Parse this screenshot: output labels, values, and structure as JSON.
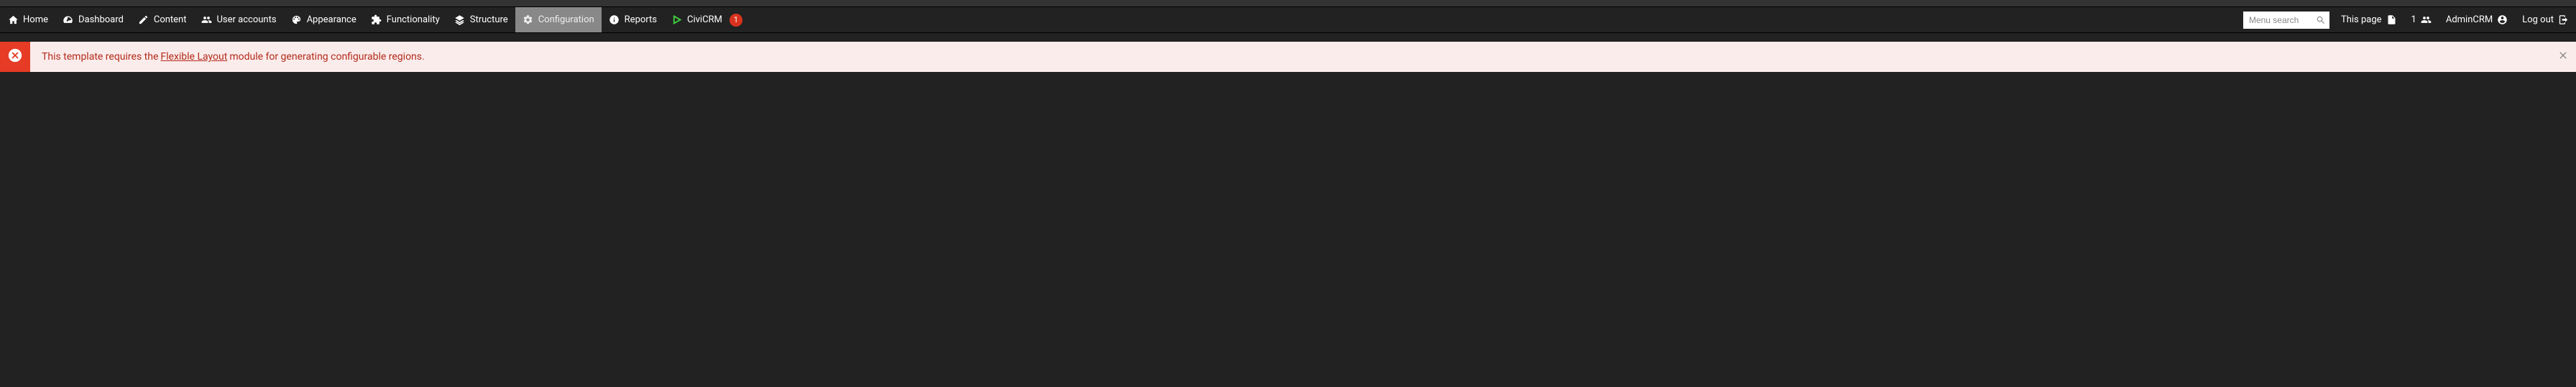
{
  "toolbar": {
    "items": [
      {
        "id": "home",
        "label": "Home",
        "icon": "home-icon"
      },
      {
        "id": "dashboard",
        "label": "Dashboard",
        "icon": "gauge-icon"
      },
      {
        "id": "content",
        "label": "Content",
        "icon": "pencil-icon"
      },
      {
        "id": "user-accounts",
        "label": "User accounts",
        "icon": "users-icon"
      },
      {
        "id": "appearance",
        "label": "Appearance",
        "icon": "palette-icon"
      },
      {
        "id": "functionality",
        "label": "Functionality",
        "icon": "puzzle-icon"
      },
      {
        "id": "structure",
        "label": "Structure",
        "icon": "layers-icon"
      },
      {
        "id": "configuration",
        "label": "Configuration",
        "icon": "gear-icon",
        "active": true
      },
      {
        "id": "reports",
        "label": "Reports",
        "icon": "info-circle-icon"
      },
      {
        "id": "civicrm",
        "label": "CiviCRM",
        "icon": "civicrm-icon",
        "badge": "1"
      }
    ]
  },
  "search": {
    "placeholder": "Menu search"
  },
  "right": {
    "this_page": {
      "label": "This page",
      "icon": "file-icon"
    },
    "users_online": {
      "count": "1",
      "icon": "users-icon"
    },
    "account": {
      "label": "AdminCRM",
      "icon": "user-circle-icon"
    },
    "logout": {
      "label": "Log out",
      "icon": "sign-out-icon"
    }
  },
  "message": {
    "text_before": "This template requires the",
    "link_text": "Flexible Layout",
    "text_after": "module for generating configurable regions."
  },
  "colors": {
    "error_bg": "#fbecec",
    "error_fg": "#b22b1a",
    "error_icon_bg": "#e63b24",
    "badge_bg": "#d9331f",
    "toolbar_bg": "#222222",
    "active_bg": "#888888"
  }
}
